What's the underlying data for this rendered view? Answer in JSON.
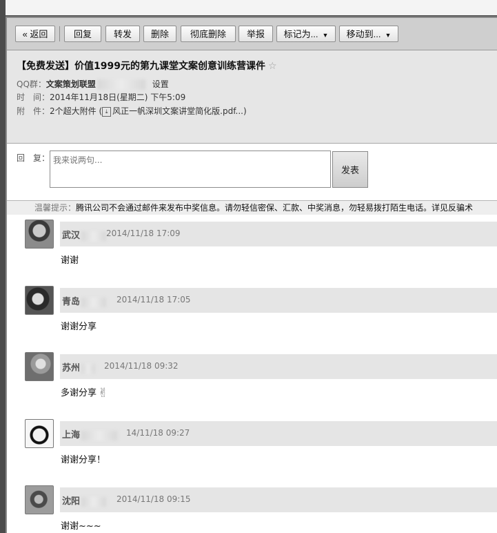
{
  "toolbar": {
    "back": "« 返回",
    "reply": "回复",
    "forward": "转发",
    "delete": "删除",
    "delete_forever": "彻底删除",
    "report": "举报",
    "mark_as": "标记为...",
    "move_to": "移动到..."
  },
  "mail": {
    "subject": "【免费发送】价值1999元的第九课堂文案创意训练营课件",
    "star_icon": "☆",
    "group_label": "QQ群：",
    "group_name": "文案策划联盟",
    "group_settings": "设置",
    "time_label": "时　间：",
    "time_value": "2014年11月18日(星期二) 下午5:09",
    "attach_label": "附　件：",
    "attach_prefix": "2个超大附件 (",
    "attach_file": "风正一帆深圳文案讲堂简化版.pdf...)"
  },
  "reply": {
    "label": "回　复：",
    "placeholder": "我来说两句...",
    "send": "发表"
  },
  "notice": {
    "label": "温馨提示：",
    "text": "腾讯公司不会通过邮件来发布中奖信息。请勿轻信密保、汇款、中奖消息，勿轻易拨打陌生电话。详见反骗术"
  },
  "comments": [
    {
      "name": "武汉",
      "date": "2014/11/18 17:09",
      "text": "谢谢"
    },
    {
      "name": "青岛",
      "date": "2014/11/18 17:05",
      "text": "谢谢分享"
    },
    {
      "name": "苏州",
      "date": "2014/11/18 09:32",
      "text": "多谢分享"
    },
    {
      "name": "上海",
      "date": "14/11/18 09:27",
      "text": "谢谢分享！"
    },
    {
      "name": "沈阳",
      "date": "2014/11/18 09:15",
      "text": "谢谢~~~"
    }
  ]
}
